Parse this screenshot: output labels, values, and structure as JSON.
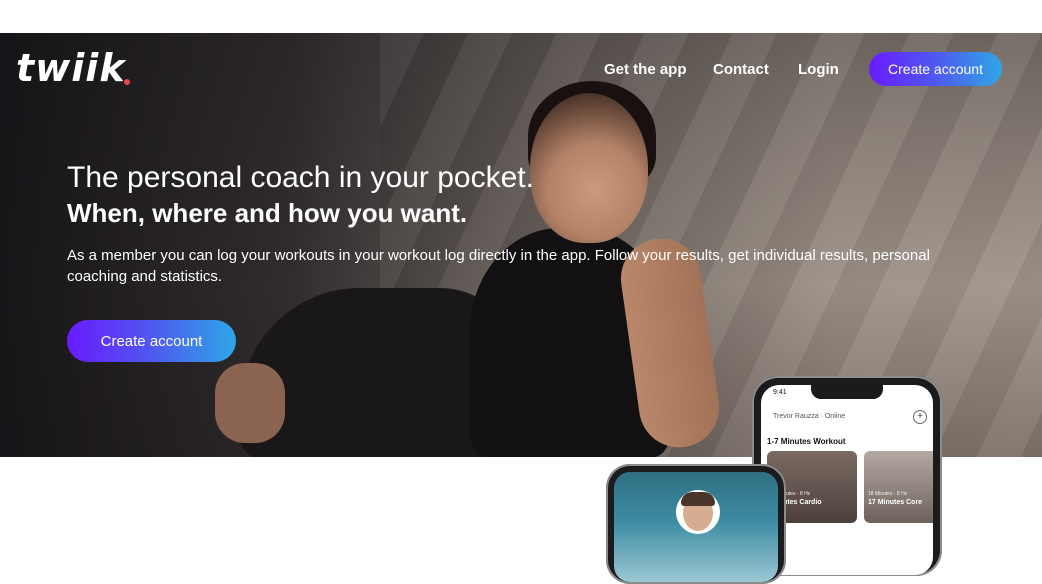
{
  "header": {
    "logo": "twiik",
    "nav": [
      {
        "label": "Get the app"
      },
      {
        "label": "Contact"
      },
      {
        "label": "Login"
      }
    ],
    "cta_label": "Create account"
  },
  "hero": {
    "title": "The personal coach in your pocket.",
    "subtitle": "When, where and how you want.",
    "description": "As a member you can log your workouts in your workout log directly in the app. Follow your results, get individual results, personal coaching and statistics.",
    "cta_label": "Create account"
  },
  "phone_mockup": {
    "back": {
      "time": "9:41",
      "user_line": "Trevor Rauzza · Online",
      "add_symbol": "+",
      "section_heading": "1-7 Minutes Workout",
      "cards": [
        {
          "meta": "18 Minutes · 8 Hz",
          "title": "Minutes Cardio"
        },
        {
          "meta": "18 Minutes · 8 Hz",
          "title": "17 Minutes Core"
        }
      ]
    }
  },
  "colors": {
    "cta_gradient_start": "#6a1bff",
    "cta_gradient_end": "#2fa7e6",
    "logo_dot": "#e5484d"
  }
}
